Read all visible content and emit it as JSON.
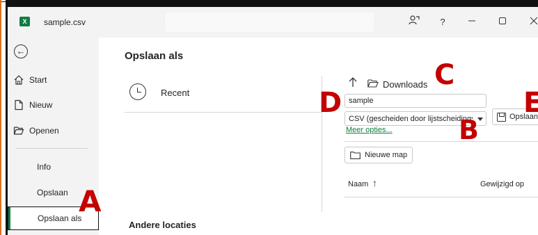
{
  "window": {
    "title": "sample.csv",
    "app_icon_letter": "X",
    "controls": {
      "present_icon": "present-icon",
      "help": "?",
      "minimize": "—",
      "maximize": "☐",
      "close": "✕"
    }
  },
  "nav": {
    "back_icon": "back-arrow-icon",
    "items": [
      {
        "label": "Start",
        "icon": "home-icon"
      },
      {
        "label": "Nieuw",
        "icon": "new-file-icon"
      },
      {
        "label": "Openen",
        "icon": "folder-open-icon"
      },
      {
        "label": "Info"
      },
      {
        "label": "Opslaan"
      },
      {
        "label": "Opslaan als",
        "selected": true
      }
    ]
  },
  "main": {
    "title": "Opslaan als",
    "recent_label": "Recent",
    "other_locations": "Andere locaties",
    "breadcrumb": "Downloads",
    "filename_value": "sample",
    "filetype_value": "CSV (gescheiden door lijstscheidingsteken) (*.csv)",
    "more_options": "Meer opties...",
    "save_label": "Opslaan",
    "new_folder_label": "Nieuwe map",
    "columns": {
      "name": "Naam",
      "sort_indicator": "↑",
      "modified": "Gewijzigd op"
    }
  },
  "markers": {
    "a": "A",
    "b": "B",
    "c": "C",
    "d": "D",
    "e": "E"
  },
  "colors": {
    "accent": "#107c41",
    "marker": "#c40000",
    "nav_bg": "#f3f3f3"
  }
}
